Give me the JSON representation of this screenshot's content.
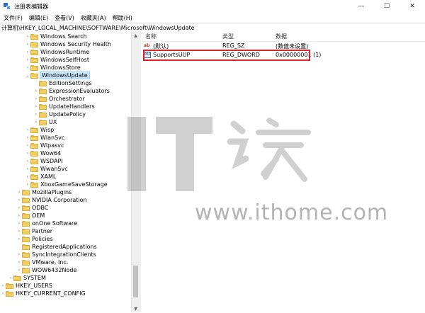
{
  "window": {
    "title": "注册表编辑器",
    "controls": {
      "minimize": "—",
      "maximize": "☐",
      "close": "✕"
    }
  },
  "menu": [
    "文件(F)",
    "编辑(E)",
    "查看(V)",
    "收藏夹(A)",
    "帮助(H)"
  ],
  "address": "计算机\\HKEY_LOCAL_MACHINE\\SOFTWARE\\Microsoft\\WindowsUpdate",
  "tree": [
    {
      "label": "Windows Search",
      "chev": "›"
    },
    {
      "label": "Windows Security Health",
      "chev": "›"
    },
    {
      "label": "WindowsRuntime",
      "chev": "›"
    },
    {
      "label": "WindowsSelfHost",
      "chev": "›"
    },
    {
      "label": "WindowsStore",
      "chev": "›"
    },
    {
      "label": "WindowsUpdate",
      "chev": "⌄"
    },
    {
      "label": "EditionSettings",
      "chev": ""
    },
    {
      "label": "ExpressionEvaluators",
      "chev": "›"
    },
    {
      "label": "Orchestrator",
      "chev": "›"
    },
    {
      "label": "UpdateHandlers",
      "chev": "›"
    },
    {
      "label": "UpdatePolicy",
      "chev": "›"
    },
    {
      "label": "UX",
      "chev": "›"
    },
    {
      "label": "Wisp",
      "chev": "›"
    },
    {
      "label": "WlanSvc",
      "chev": "›"
    },
    {
      "label": "Wlpasvc",
      "chev": "›"
    },
    {
      "label": "Wow64",
      "chev": "›"
    },
    {
      "label": "WSDAPI",
      "chev": "›"
    },
    {
      "label": "WwanSvc",
      "chev": "›"
    },
    {
      "label": "XAML",
      "chev": "›"
    },
    {
      "label": "XboxGameSaveStorage",
      "chev": "›"
    },
    {
      "label": "MozillaPlugins",
      "chev": "›"
    },
    {
      "label": "NVIDIA Corporation",
      "chev": "›"
    },
    {
      "label": "ODBC",
      "chev": "›"
    },
    {
      "label": "OEM",
      "chev": "›"
    },
    {
      "label": "onOne Software",
      "chev": "›"
    },
    {
      "label": "Partner",
      "chev": "›"
    },
    {
      "label": "Policies",
      "chev": "›"
    },
    {
      "label": "RegisteredApplications",
      "chev": ""
    },
    {
      "label": "SyncIntegrationClients",
      "chev": "›"
    },
    {
      "label": "VMware, Inc.",
      "chev": "›"
    },
    {
      "label": "WOW6432Node",
      "chev": "›"
    },
    {
      "label": "SYSTEM",
      "chev": "›"
    },
    {
      "label": "HKEY_USERS",
      "chev": "›"
    },
    {
      "label": "HKEY_CURRENT_CONFIG",
      "chev": "›"
    }
  ],
  "list": {
    "headers": {
      "name": "名称",
      "type": "类型",
      "data": "数据"
    },
    "rows": [
      {
        "icon": "ab",
        "name": "(默认)",
        "type": "REG_SZ",
        "data": "(数值未设置)"
      },
      {
        "icon": "bin",
        "name": "SupportsUUP",
        "type": "REG_DWORD",
        "data": "0x00000001 (1)"
      }
    ]
  },
  "scrollbar": {
    "up": "▲",
    "down": "▼"
  },
  "icons": {
    "ab": "ab",
    "bin": "011"
  },
  "watermark": {
    "text": "www.ithome.com",
    "logo_color": "#000000"
  }
}
